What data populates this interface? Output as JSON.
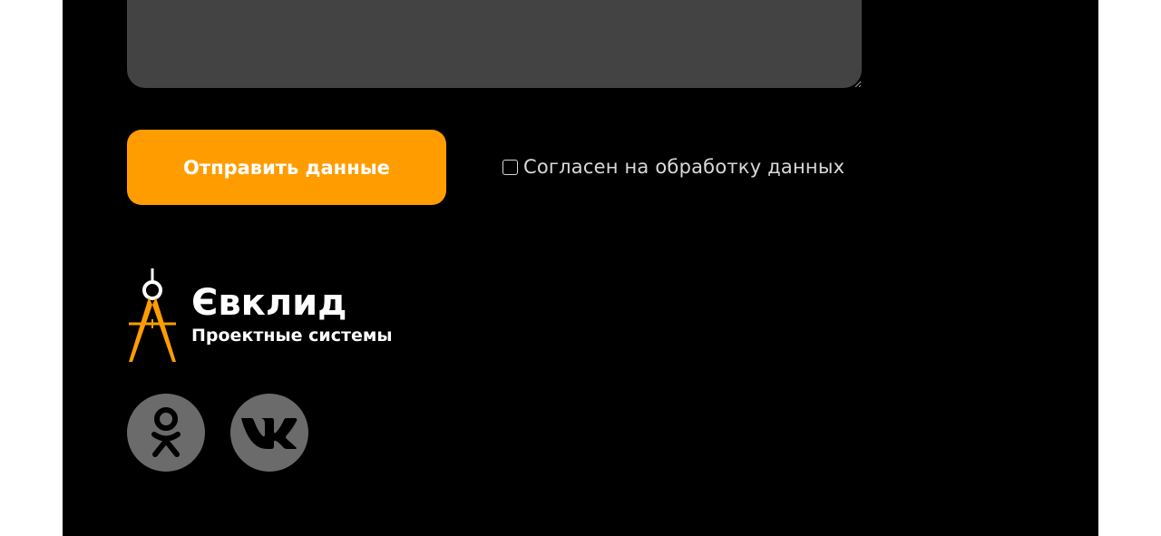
{
  "form": {
    "submit_label": "Отправить данные",
    "consent_label": "Согласен на обработку данных",
    "consent_checked": false
  },
  "brand": {
    "name": "Євклид",
    "tagline": "Проектные системы",
    "logo_icon": "compass-icon"
  },
  "social": [
    {
      "name": "odnoklassniki",
      "icon": "odnoklassniki-icon"
    },
    {
      "name": "vkontakte",
      "icon": "vk-icon"
    }
  ],
  "colors": {
    "accent": "#ff9d00",
    "background": "#000000",
    "field": "#434343",
    "social_bg": "#6b6b6b",
    "text_muted": "#d9d9d9"
  }
}
